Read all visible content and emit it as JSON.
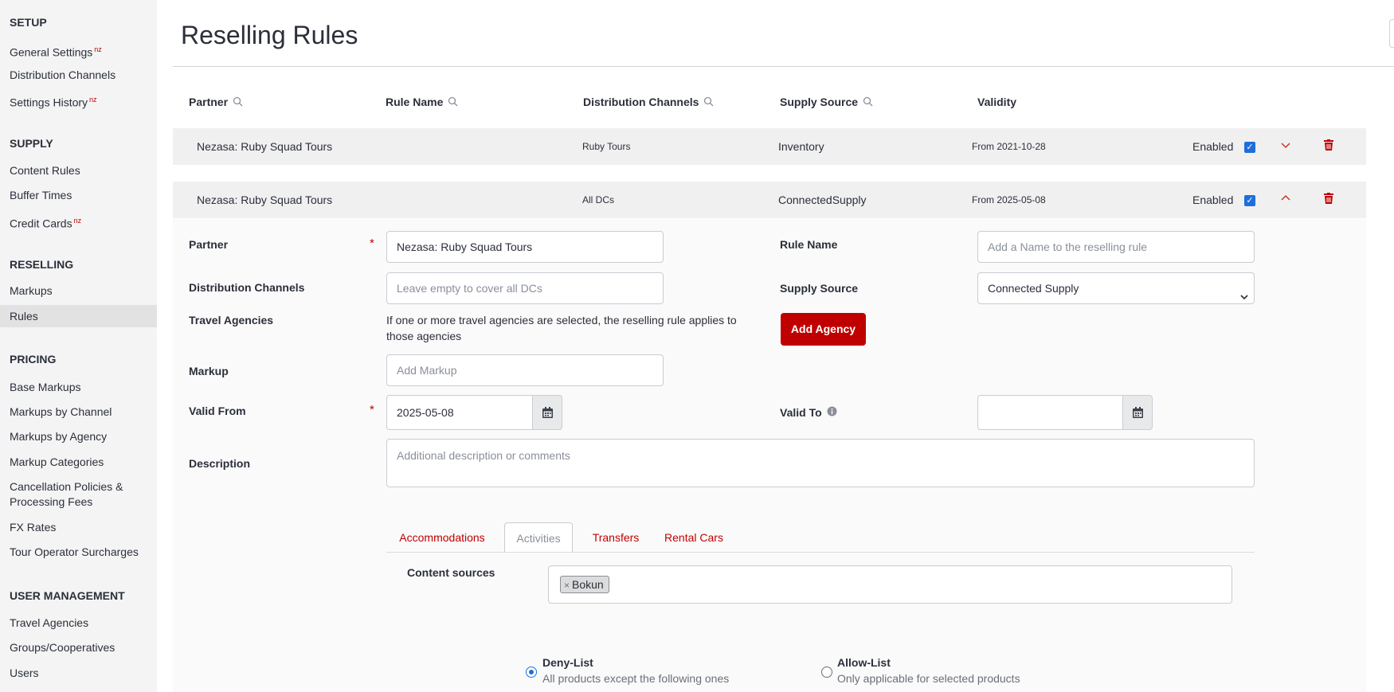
{
  "sidebar": {
    "sections": [
      {
        "title": "SETUP",
        "items": [
          {
            "label": "General Settings",
            "badge": "nz"
          },
          {
            "label": "Distribution Channels",
            "badge": ""
          },
          {
            "label": "Settings History",
            "badge": "nz"
          }
        ]
      },
      {
        "title": "SUPPLY",
        "items": [
          {
            "label": "Content Rules",
            "badge": ""
          },
          {
            "label": "Buffer Times",
            "badge": ""
          },
          {
            "label": "Credit Cards",
            "badge": "nz"
          }
        ]
      },
      {
        "title": "RESELLING",
        "items": [
          {
            "label": "Markups",
            "badge": ""
          },
          {
            "label": "Rules",
            "badge": ""
          }
        ]
      },
      {
        "title": "PRICING",
        "items": [
          {
            "label": "Base Markups",
            "badge": ""
          },
          {
            "label": "Markups by Channel",
            "badge": ""
          },
          {
            "label": "Markups by Agency",
            "badge": ""
          },
          {
            "label": "Markup Categories",
            "badge": ""
          },
          {
            "label": "Cancellation Policies & Processing Fees",
            "badge": ""
          },
          {
            "label": "FX Rates",
            "badge": ""
          },
          {
            "label": "Tour Operator Surcharges",
            "badge": ""
          }
        ]
      },
      {
        "title": "USER MANAGEMENT",
        "items": [
          {
            "label": "Travel Agencies",
            "badge": ""
          },
          {
            "label": "Groups/Cooperatives",
            "badge": ""
          },
          {
            "label": "Users",
            "badge": ""
          }
        ]
      }
    ]
  },
  "page": {
    "title": "Reselling Rules"
  },
  "table": {
    "columns": [
      "Partner",
      "Rule Name",
      "Distribution Channels",
      "Supply Source",
      "Validity"
    ],
    "rows": [
      {
        "partner": "Nezasa: Ruby Squad Tours",
        "rule_name": "",
        "channels": "Ruby Tours",
        "supply": "Inventory",
        "validity": "From 2021-10-28",
        "status": "Enabled",
        "enabled": true
      },
      {
        "partner": "Nezasa: Ruby Squad Tours",
        "rule_name": "",
        "channels": "All DCs",
        "supply": "ConnectedSupply",
        "validity": "From 2025-05-08",
        "status": "Enabled",
        "enabled": true
      }
    ]
  },
  "form": {
    "partner_label": "Partner",
    "partner_value": "Nezasa: Ruby Squad Tours",
    "rule_name_label": "Rule Name",
    "rule_name_placeholder": "Add a Name to the reselling rule",
    "channels_label": "Distribution Channels",
    "channels_placeholder": "Leave empty to cover all DCs",
    "supply_label": "Supply Source",
    "supply_value": "Connected Supply",
    "agencies_label": "Travel Agencies",
    "agencies_help": "If one or more travel agencies are selected, the reselling rule applies to those agencies",
    "add_agency_button": "Add Agency",
    "markup_label": "Markup",
    "markup_placeholder": "Add Markup",
    "valid_from_label": "Valid From",
    "valid_from_value": "2025-05-08",
    "valid_to_label": "Valid To",
    "valid_to_value": "",
    "description_label": "Description",
    "description_placeholder": "Additional description or comments",
    "required_mark": "*"
  },
  "tabs": {
    "items": [
      "Accommodations",
      "Activities",
      "Transfers",
      "Rental Cars"
    ],
    "active": "Activities"
  },
  "content_sources": {
    "label": "Content sources",
    "chips": [
      "Bokun"
    ],
    "chip_remove": "×"
  },
  "list_mode": {
    "options": [
      {
        "title": "Deny-List",
        "subtitle": "All products except the following ones",
        "selected": true
      },
      {
        "title": "Allow-List",
        "subtitle": "Only applicable for selected products",
        "selected": false
      }
    ]
  },
  "colors": {
    "accent": "#c00000",
    "checkbox": "#1e6fd9",
    "sidebar_bg": "#f4f4f4"
  },
  "icons": [
    "search-icon",
    "chevron-down-icon",
    "chevron-up-icon",
    "trash-icon",
    "calendar-icon",
    "info-icon"
  ]
}
